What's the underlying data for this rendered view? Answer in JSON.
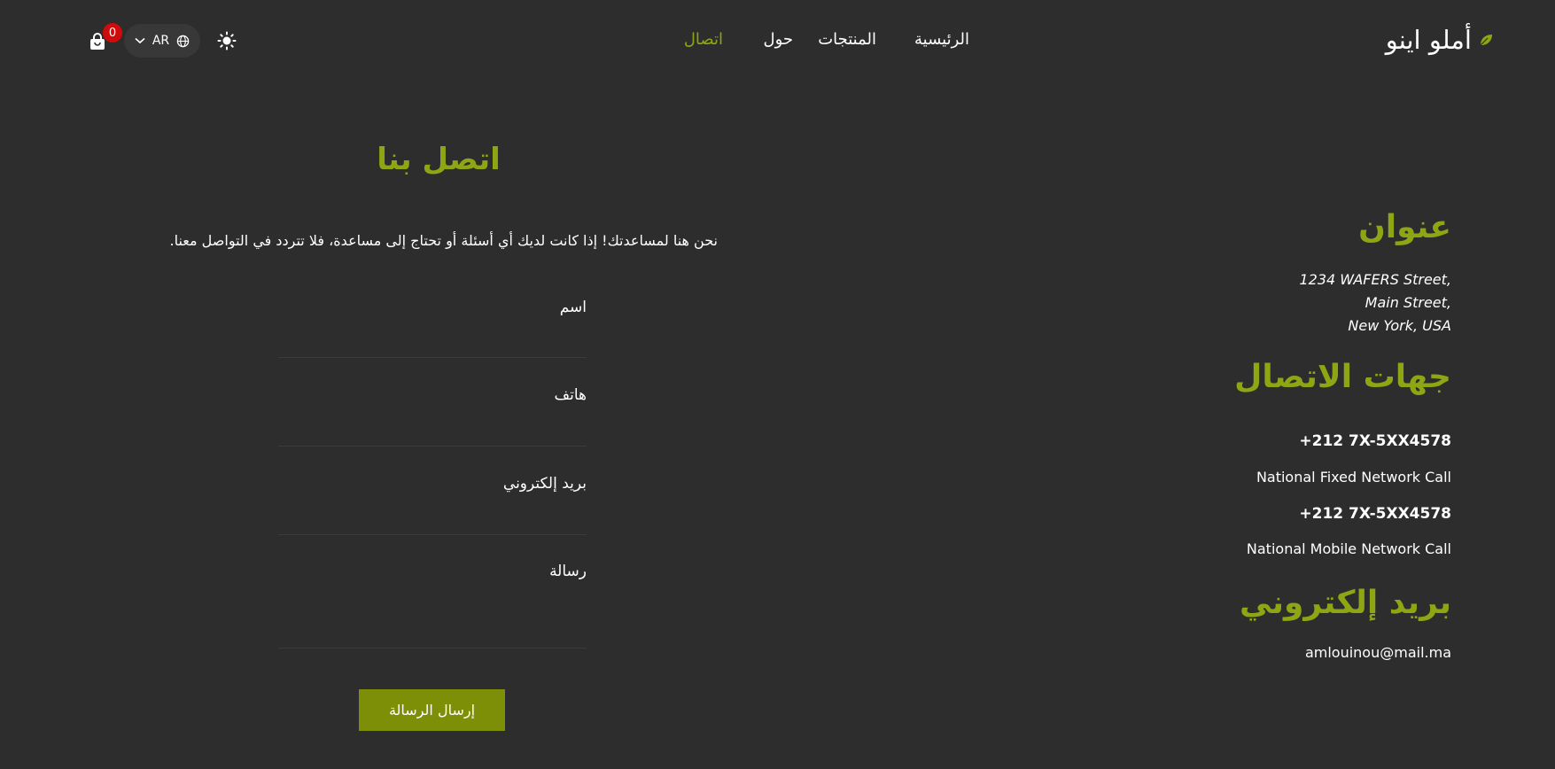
{
  "header": {
    "brand": "أملو اينو",
    "nav": [
      "الرئيسية",
      "المنتجات",
      "حول",
      "اتصال"
    ],
    "active_index": 3,
    "language": "AR",
    "cart_count": "0"
  },
  "colors": {
    "accent": "#8ea614",
    "button": "#7d8f06",
    "background": "#2d2d2d",
    "badge": "#d00b0b"
  },
  "icons": {
    "brand": "leaf-icon",
    "theme": "sun-icon",
    "language": "globe-icon",
    "dropdown": "chevron-down-icon",
    "cart": "shopping-bag-icon"
  },
  "contact_form": {
    "title": "اتصل بنا",
    "intro": "نحن هنا لمساعدتك! إذا كانت لديك أي أسئلة أو تحتاج إلى مساعدة، فلا تتردد في التواصل معنا.",
    "fields": {
      "name": "اسم",
      "phone": "هاتف",
      "email": "بريد إلكتروني",
      "message": "رسالة"
    },
    "submit": "إرسال الرسالة"
  },
  "info": {
    "address_title": "عنوان",
    "address_lines": [
      "1234 WAFERS Street,",
      "Main Street,",
      "New York, USA"
    ],
    "contacts_title": "جهات الاتصال",
    "phones": [
      {
        "number": "+212 7X-5XX4578",
        "desc": "National Fixed Network Call"
      },
      {
        "number": "+212 7X-5XX4578",
        "desc": "National Mobile Network Call"
      }
    ],
    "email_title": "بريد إلكتروني",
    "email": "amlouinou@mail.ma"
  }
}
